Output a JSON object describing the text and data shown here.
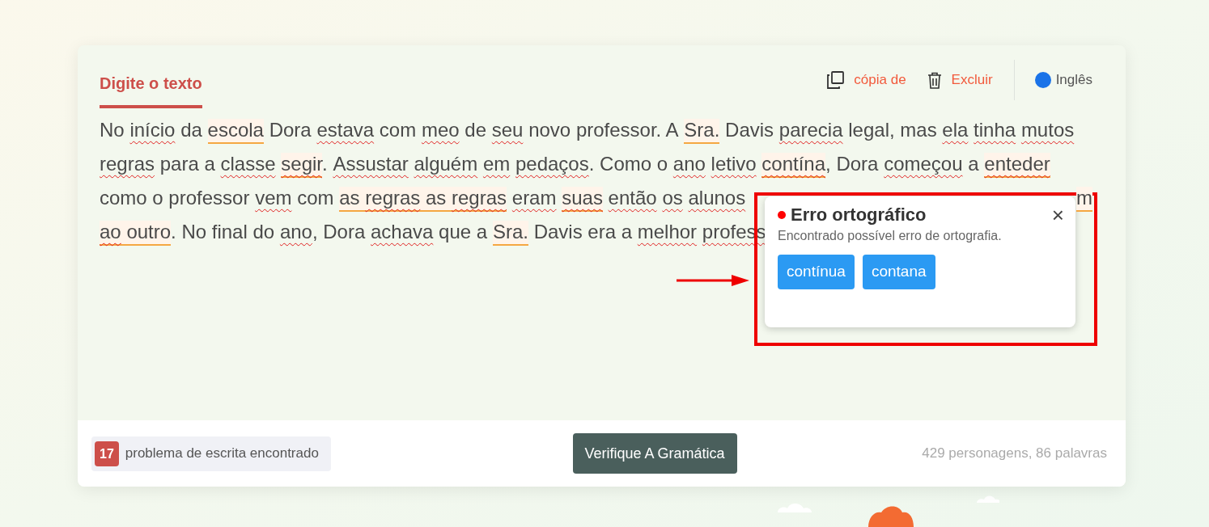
{
  "tabs": [
    {
      "label": "Digite o texto",
      "selected": true
    }
  ],
  "toolbar": {
    "actions": [
      {
        "kind": "copy",
        "label": "cópia de"
      },
      {
        "kind": "delete",
        "label": "Excluir"
      }
    ],
    "language": "Inglês"
  },
  "editor": {
    "lines": [
      {
        "left": [
          {
            "kind": "plain",
            "text": "No"
          },
          {
            "kind": "misspelled",
            "text": "início",
            "joined": false
          },
          {
            "kind": "plain",
            "text": "da",
            "joined": false
          },
          {
            "kind": "flagged",
            "joined": false,
            "parts": [
              {
                "text": "escola",
                "misspelled": false
              }
            ]
          },
          {
            "kind": "plain",
            "text": "Dora",
            "joined": false
          },
          {
            "kind": "misspelled",
            "text": "estava",
            "joined": false
          },
          {
            "kind": "plain",
            "text": "com",
            "joined": false
          },
          {
            "kind": "misspelled",
            "text": "meo",
            "joined": false
          },
          {
            "kind": "plain",
            "text": "de",
            "joined": false
          },
          {
            "kind": "misspelled",
            "text": "seu",
            "joined": false
          },
          {
            "kind": "plain",
            "text": "novo professor. A",
            "joined": false
          },
          {
            "kind": "flagged",
            "joined": false,
            "parts": [
              {
                "text": "Sra.",
                "misspelled": false
              }
            ]
          },
          {
            "kind": "plain",
            "text": "Davis",
            "joined": false
          },
          {
            "kind": "misspelled",
            "text": "parecia",
            "joined": false
          },
          {
            "kind": "plain",
            "text": "legal, mas",
            "joined": false
          },
          {
            "kind": "misspelled",
            "text": "ela",
            "joined": false
          },
          {
            "kind": "misspelled",
            "text": "tinha",
            "joined": false
          },
          {
            "kind": "misspelled",
            "text": "mutos",
            "joined": false
          }
        ]
      },
      {
        "left": [
          {
            "kind": "misspelled",
            "text": "regras"
          },
          {
            "kind": "plain",
            "text": "para a",
            "joined": false
          },
          {
            "kind": "misspelled",
            "text": "classe",
            "joined": false
          },
          {
            "kind": "flagged",
            "joined": false,
            "parts": [
              {
                "text": "segir",
                "misspelled": true
              }
            ]
          },
          {
            "kind": "plain",
            "text": ".",
            "joined": true
          },
          {
            "kind": "misspelled",
            "text": "Assustar",
            "joined": false
          },
          {
            "kind": "misspelled",
            "text": "alguém",
            "joined": false
          },
          {
            "kind": "misspelled",
            "text": "em",
            "joined": false
          },
          {
            "kind": "misspelled",
            "text": "pedaços",
            "joined": false
          },
          {
            "kind": "plain",
            "text": ". Como o",
            "joined": true
          },
          {
            "kind": "misspelled",
            "text": "ano",
            "joined": false
          },
          {
            "kind": "misspelled",
            "text": "letivo",
            "joined": false
          },
          {
            "kind": "flagged",
            "joined": false,
            "parts": [
              {
                "text": "contína",
                "misspelled": true
              }
            ]
          },
          {
            "kind": "plain",
            "text": ", Dora",
            "joined": true
          },
          {
            "kind": "misspelled",
            "text": "começou",
            "joined": false
          },
          {
            "kind": "plain",
            "text": "a",
            "joined": false
          },
          {
            "kind": "flagged",
            "joined": false,
            "parts": [
              {
                "text": "enteder",
                "misspelled": true
              }
            ]
          }
        ]
      },
      {
        "left": [
          {
            "kind": "plain",
            "text": "como o professor"
          },
          {
            "kind": "misspelled",
            "text": "vem",
            "joined": false
          },
          {
            "kind": "plain",
            "text": "com",
            "joined": false
          },
          {
            "kind": "flagged",
            "joined": false,
            "parts": [
              {
                "text": "as",
                "misspelled": false
              },
              {
                "text": "regras",
                "misspelled": true
              },
              {
                "text": "as",
                "misspelled": false
              },
              {
                "text": "regras",
                "misspelled": true
              }
            ]
          },
          {
            "kind": "misspelled",
            "text": "eram",
            "joined": false
          },
          {
            "kind": "flagged",
            "joined": false,
            "parts": [
              {
                "text": "suas",
                "misspelled": true
              }
            ]
          },
          {
            "kind": "misspelled",
            "text": "então",
            "joined": false
          },
          {
            "kind": "misspelled",
            "text": "os",
            "joined": false
          },
          {
            "kind": "misspelled",
            "text": "alunos",
            "joined": false
          }
        ],
        "right": [
          {
            "kind": "flagged",
            "parts": [
              {
                "text": "m",
                "misspelled": false
              }
            ]
          }
        ]
      },
      {
        "left": [
          {
            "kind": "flagged",
            "parts": [
              {
                "text": "ao",
                "misspelled": true
              },
              {
                "text": "outro",
                "misspelled": false
              }
            ]
          },
          {
            "kind": "plain",
            "text": ". No final do",
            "joined": true
          },
          {
            "kind": "misspelled",
            "text": "ano",
            "joined": false
          },
          {
            "kind": "plain",
            "text": ", Dora",
            "joined": true
          },
          {
            "kind": "misspelled",
            "text": "achava",
            "joined": false
          },
          {
            "kind": "plain",
            "text": "que a",
            "joined": false
          },
          {
            "kind": "flagged",
            "joined": false,
            "parts": [
              {
                "text": "Sra.",
                "misspelled": false
              }
            ]
          },
          {
            "kind": "plain",
            "text": "Davis era a",
            "joined": false
          },
          {
            "kind": "misspelled",
            "text": "melhor",
            "joined": false
          },
          {
            "kind": "misspelled",
            "text": "profess",
            "joined": false
          }
        ]
      }
    ]
  },
  "popup": {
    "title": "Erro ortográfico",
    "description": "Encontrado possível erro de ortografia.",
    "suggestions": [
      "contínua",
      "contana"
    ],
    "close": "×"
  },
  "footer": {
    "count": "17",
    "issues": "problema de escrita encontrado",
    "button": "Verifique A Gramática",
    "stats": "429 personagens, 86 palavras"
  }
}
